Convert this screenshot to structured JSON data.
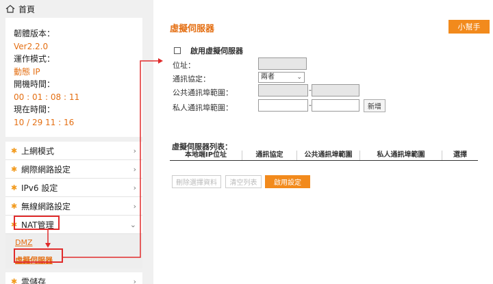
{
  "sidebar": {
    "home_label": "首頁",
    "info": [
      {
        "label": "韌體版本：",
        "value": "Ver2.2.0"
      },
      {
        "label": "運作模式：",
        "value": "動態 IP"
      },
      {
        "label": "開機時間：",
        "value": "00 : 01 : 08 : 11"
      },
      {
        "label": "現在時間：",
        "value": "10 / 29  11 : 16"
      }
    ],
    "menu": [
      {
        "label": "上網模式",
        "chevron": "›"
      },
      {
        "label": "網際網路設定",
        "chevron": "›"
      },
      {
        "label": "IPv6 設定",
        "chevron": "›"
      },
      {
        "label": "無線網路設定",
        "chevron": "›"
      },
      {
        "label": "NAT管理",
        "chevron": "⌄"
      }
    ],
    "submenu": [
      {
        "label": "DMZ"
      },
      {
        "label": "虛擬伺服器"
      }
    ],
    "after_menu": [
      {
        "label": "雲儲存",
        "chevron": "›"
      }
    ]
  },
  "main": {
    "title": "虛擬伺服器",
    "help_label": "小幫手",
    "enable_label": "啟用虛擬伺服器",
    "address_label": "位址：",
    "protocol_label": "通訊協定：",
    "protocol_value": "兩者",
    "public_port_label": "公共通訊埠範圍：",
    "private_port_label": "私人通訊埠範圍：",
    "add_button": "新增",
    "list_title": "虛擬伺服器列表：",
    "columns": [
      "本地端IP位址",
      "通訊協定",
      "公共通訊埠範圍",
      "私人通訊埠範圍",
      "選擇"
    ],
    "delete_selected": "刪除選擇資料",
    "clear_list": "清空列表",
    "apply": "啟用設定"
  },
  "colors": {
    "accent": "#e46f13",
    "button_orange": "#f28a1c",
    "annotation_red": "#e02b2b"
  }
}
